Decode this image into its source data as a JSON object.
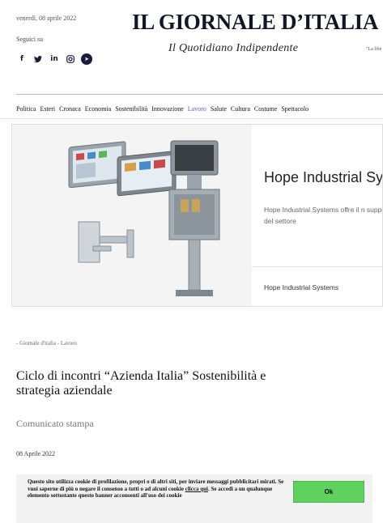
{
  "header": {
    "date": "venerdì, 08 aprile 2022",
    "follow_label": "Seguici su",
    "socials": [
      {
        "icon": "facebook-icon",
        "glyph": "f"
      },
      {
        "icon": "twitter-icon",
        "glyph": "🐦"
      },
      {
        "icon": "linkedin-icon",
        "glyph": "in"
      },
      {
        "icon": "instagram-icon",
        "glyph": "◎"
      },
      {
        "icon": "telegram-icon",
        "glyph": "➤"
      }
    ],
    "logo_title": "IL GIORNALE D’ITALIA",
    "logo_subtitle": "Il Quotidiano Indipendente",
    "corner_text": "\"La libe"
  },
  "nav": {
    "items": [
      "Politica",
      "Esteri",
      "Cronaca",
      "Economia",
      "Sostenibilità",
      "Innovazione",
      "Lavoro",
      "Salute",
      "Cultura",
      "Costume",
      "Spettacolo"
    ],
    "active": "Lavoro"
  },
  "ad": {
    "title": "Hope Industrial Sys",
    "description": "Hope Industrial Systems offre il n supporto del settore",
    "brand": "Hope Industrial Systems"
  },
  "article": {
    "breadcrumb": "- Giornale d'italia - Lavoro",
    "title": "Ciclo di incontri “Azienda Italia” Sostenibilità e strategia aziendale",
    "subtitle": "Comunicato stampa",
    "date": "08 Aprile 2022"
  },
  "cookie": {
    "text_before": "Questo sito utilizza cookie di profilazione, propri o di altri siti, per inviare messaggi pubblicitari mirati. Se vuoi saperne di più o negare il consenso a tutti o ad alcuni cookie ",
    "link": "clicca qui",
    "text_after": ". Se accedi a un qualunque elemento sottostante questo banner acconsenti all'uso dei cookie",
    "button": "Ok"
  },
  "colors": {
    "active_nav": "#5b5bd6",
    "ok_button": "#5fd15f",
    "cookie_bg": "#f2f2f2"
  }
}
